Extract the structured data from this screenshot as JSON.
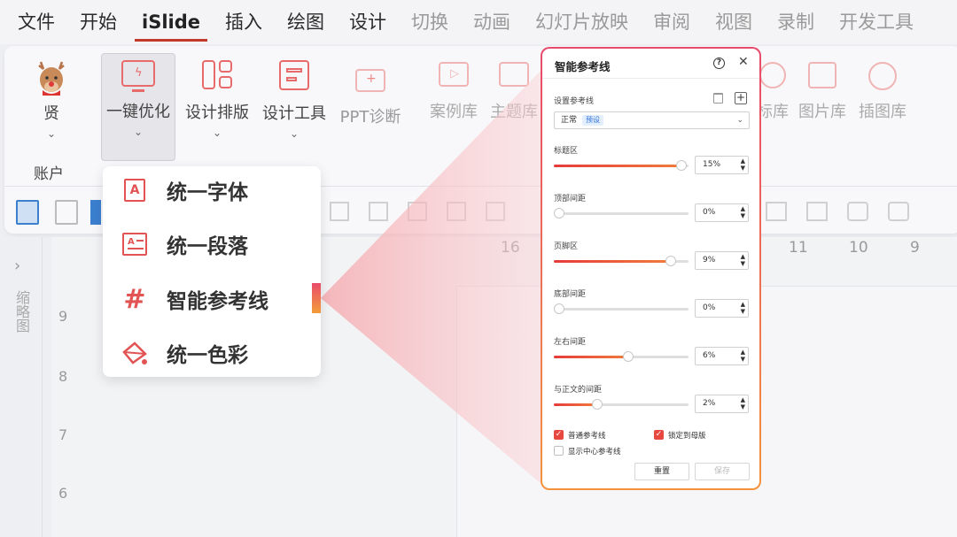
{
  "menubar": {
    "tabs": [
      "文件",
      "开始",
      "iSlide",
      "插入",
      "绘图",
      "设计",
      "切换",
      "动画",
      "幻灯片放映",
      "审阅",
      "视图",
      "录制",
      "开发工具"
    ],
    "active_index": 2
  },
  "ribbon": {
    "account_name": "贤",
    "account_group": "账户",
    "buttons": [
      "一键优化",
      "设计排版",
      "设计工具",
      "PPT诊断",
      "案例库",
      "主题库",
      "标库",
      "图片库",
      "插图库"
    ]
  },
  "dropdown": {
    "items": [
      "统一字体",
      "统一段落",
      "智能参考线",
      "统一色彩"
    ]
  },
  "ruler": {
    "h_ticks": [
      "16",
      "11",
      "10",
      "9"
    ],
    "v_ticks": [
      "9",
      "8",
      "7",
      "6"
    ]
  },
  "sidebar": {
    "expand_glyph": "›",
    "thumbnails_label": "缩略图"
  },
  "panel": {
    "title": "智能参考线",
    "help": "?",
    "close": "✕",
    "set_guide_label": "设置参考线",
    "preset_value": "正常",
    "preset_tag": "预设",
    "sliders": [
      {
        "label": "标题区",
        "value": "15%",
        "level": 0.95
      },
      {
        "label": "顶部间距",
        "value": "0%",
        "level": 0.0
      },
      {
        "label": "页脚区",
        "value": "9%",
        "level": 0.87
      },
      {
        "label": "底部间距",
        "value": "0%",
        "level": 0.0
      },
      {
        "label": "左右间距",
        "value": "6%",
        "level": 0.55
      },
      {
        "label": "与正文的间距",
        "value": "2%",
        "level": 0.32
      }
    ],
    "checkboxes": [
      {
        "label": "普通参考线",
        "checked": true
      },
      {
        "label": "锁定到母版",
        "checked": true
      },
      {
        "label": "显示中心参考线",
        "checked": false
      }
    ],
    "reset_label": "重置",
    "save_label": "保存"
  },
  "colors": {
    "accent": "#e7483f",
    "gradient_start": "#e84a6c",
    "gradient_end": "#f4923c"
  }
}
